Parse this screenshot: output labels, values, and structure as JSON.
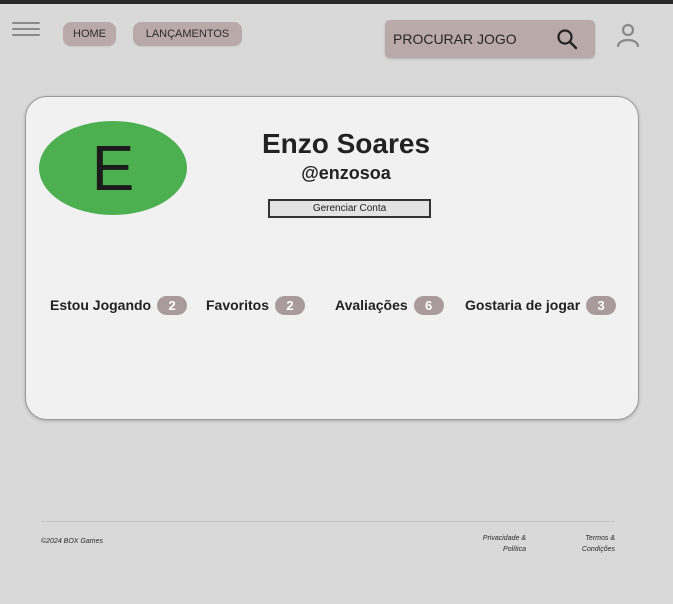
{
  "header": {
    "menu_icon": "hamburger-menu-icon",
    "nav": {
      "home": "HOME",
      "releases": "LANÇAMENTOS"
    },
    "search": {
      "placeholder": "PROCURAR JOGO",
      "icon": "search-icon"
    },
    "user_icon": "user-icon"
  },
  "profile": {
    "avatar_initial": "E",
    "avatar_color": "#4caf50",
    "name": "Enzo Soares",
    "handle": "@enzosoa",
    "manage_label": "Gerenciar Conta"
  },
  "stats": [
    {
      "label": "Estou Jogando",
      "count": "2"
    },
    {
      "label": "Favoritos",
      "count": "2"
    },
    {
      "label": "Avaliações",
      "count": "6"
    },
    {
      "label": "Gostaria de jogar",
      "count": "3"
    }
  ],
  "footer": {
    "copyright": "©2024 BOX Games",
    "privacy_line1": "Privacidade &",
    "privacy_line2": "Política",
    "terms_line1": "Termos &",
    "terms_line2": "Condições"
  },
  "colors": {
    "background": "#d9d9d9",
    "nav_pill": "#b9aaa9",
    "card": "#f2f1f1",
    "badge": "#a99b9b"
  }
}
